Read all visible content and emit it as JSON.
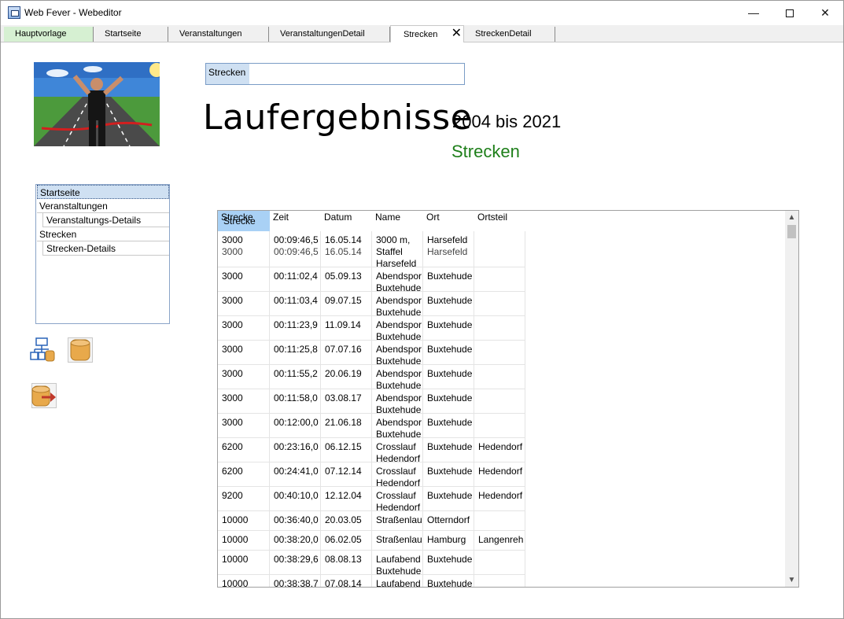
{
  "window": {
    "title": "Web Fever - Webeditor"
  },
  "tabs": [
    {
      "label": "Hauptvorlage"
    },
    {
      "label": "Startseite"
    },
    {
      "label": "Veranstaltungen"
    },
    {
      "label": "VeranstaltungenDetail"
    },
    {
      "label": "Strecken"
    },
    {
      "label": "StreckenDetail"
    }
  ],
  "active_tab": "Strecken",
  "search": {
    "label": "Strecken",
    "value": ""
  },
  "heading": {
    "title": "Laufergebnisse",
    "years": "2004 bis 2021",
    "subtitle": "Strecken"
  },
  "nav": {
    "items": [
      {
        "label": "Startseite"
      },
      {
        "label": "Veranstaltungen"
      },
      {
        "label": "Veranstaltungs-Details"
      },
      {
        "label": "Strecken"
      },
      {
        "label": "Strecken-Details"
      }
    ]
  },
  "tools": [
    {
      "icon": "sitemap-database-icon"
    },
    {
      "icon": "database-icon"
    },
    {
      "icon": "database-export-icon"
    }
  ],
  "grid": {
    "columns": [
      "Strecke",
      "Zeit",
      "Datum",
      "Name",
      "Ort",
      "Ortsteil"
    ],
    "header_overlay": "Strecke",
    "rows": [
      {
        "strecke": "3000",
        "zeit": "00:09:46,5",
        "datum": "16.05.14",
        "name": "3000 m, Staffel Harsefeld",
        "ort": "Harsefeld",
        "ortsteil": "",
        "ghost": [
          "3000",
          "00:09:46,5",
          "16.05.14",
          "",
          "Harsefeld",
          ""
        ]
      },
      {
        "strecke": "3000",
        "zeit": "00:11:02,4",
        "datum": "05.09.13",
        "name": "Abendspor",
        "name2": "Buxtehude",
        "ort": "Buxtehude",
        "ortsteil": ""
      },
      {
        "strecke": "3000",
        "zeit": "00:11:03,4",
        "datum": "09.07.15",
        "name": "Abendspor",
        "name2": "Buxtehude",
        "ort": "Buxtehude",
        "ortsteil": ""
      },
      {
        "strecke": "3000",
        "zeit": "00:11:23,9",
        "datum": "11.09.14",
        "name": "Abendspor",
        "name2": "Buxtehude",
        "ort": "Buxtehude",
        "ortsteil": ""
      },
      {
        "strecke": "3000",
        "zeit": "00:11:25,8",
        "datum": "07.07.16",
        "name": "Abendspor",
        "name2": "Buxtehude",
        "ort": "Buxtehude",
        "ortsteil": ""
      },
      {
        "strecke": "3000",
        "zeit": "00:11:55,2",
        "datum": "20.06.19",
        "name": "Abendspor",
        "name2": "Buxtehude",
        "ort": "Buxtehude",
        "ortsteil": ""
      },
      {
        "strecke": "3000",
        "zeit": "00:11:58,0",
        "datum": "03.08.17",
        "name": "Abendspor",
        "name2": "Buxtehude",
        "ort": "Buxtehude",
        "ortsteil": ""
      },
      {
        "strecke": "3000",
        "zeit": "00:12:00,0",
        "datum": "21.06.18",
        "name": "Abendspor",
        "name2": "Buxtehude",
        "ort": "Buxtehude",
        "ortsteil": ""
      },
      {
        "strecke": "6200",
        "zeit": "00:23:16,0",
        "datum": "06.12.15",
        "name": "Crosslauf",
        "name2": "Hedendorf",
        "ort": "Buxtehude",
        "ortsteil": "Hedendorf"
      },
      {
        "strecke": "6200",
        "zeit": "00:24:41,0",
        "datum": "07.12.14",
        "name": "Crosslauf",
        "name2": "Hedendorf",
        "ort": "Buxtehude",
        "ortsteil": "Hedendorf"
      },
      {
        "strecke": "9200",
        "zeit": "00:40:10,0",
        "datum": "12.12.04",
        "name": "Crosslauf",
        "name2": "Hedendorf",
        "ort": "Buxtehude",
        "ortsteil": "Hedendorf"
      },
      {
        "strecke": "10000",
        "zeit": "00:36:40,0",
        "datum": "20.03.05",
        "name": "Straßenlau",
        "name2": "",
        "ort": "Otterndorf",
        "ortsteil": ""
      },
      {
        "strecke": "10000",
        "zeit": "00:38:20,0",
        "datum": "06.02.05",
        "name": "Straßenlau",
        "name2": "",
        "ort": "Hamburg",
        "ortsteil": "Langenreh"
      },
      {
        "strecke": "10000",
        "zeit": "00:38:29,6",
        "datum": "08.08.13",
        "name": "Laufabend",
        "name2": "Buxtehude",
        "ort": "Buxtehude",
        "ortsteil": ""
      },
      {
        "strecke": "10000",
        "zeit": "00:38:38,7",
        "datum": "07.08.14",
        "name": "Laufabend",
        "name2": "",
        "ort": "Buxtehude",
        "ortsteil": ""
      }
    ]
  },
  "colors": {
    "accent_green": "#1e7f1a",
    "selection_blue": "#cfe0f2",
    "header_blue": "#a9d1f5",
    "first_tab_green": "#d6f0d2"
  }
}
